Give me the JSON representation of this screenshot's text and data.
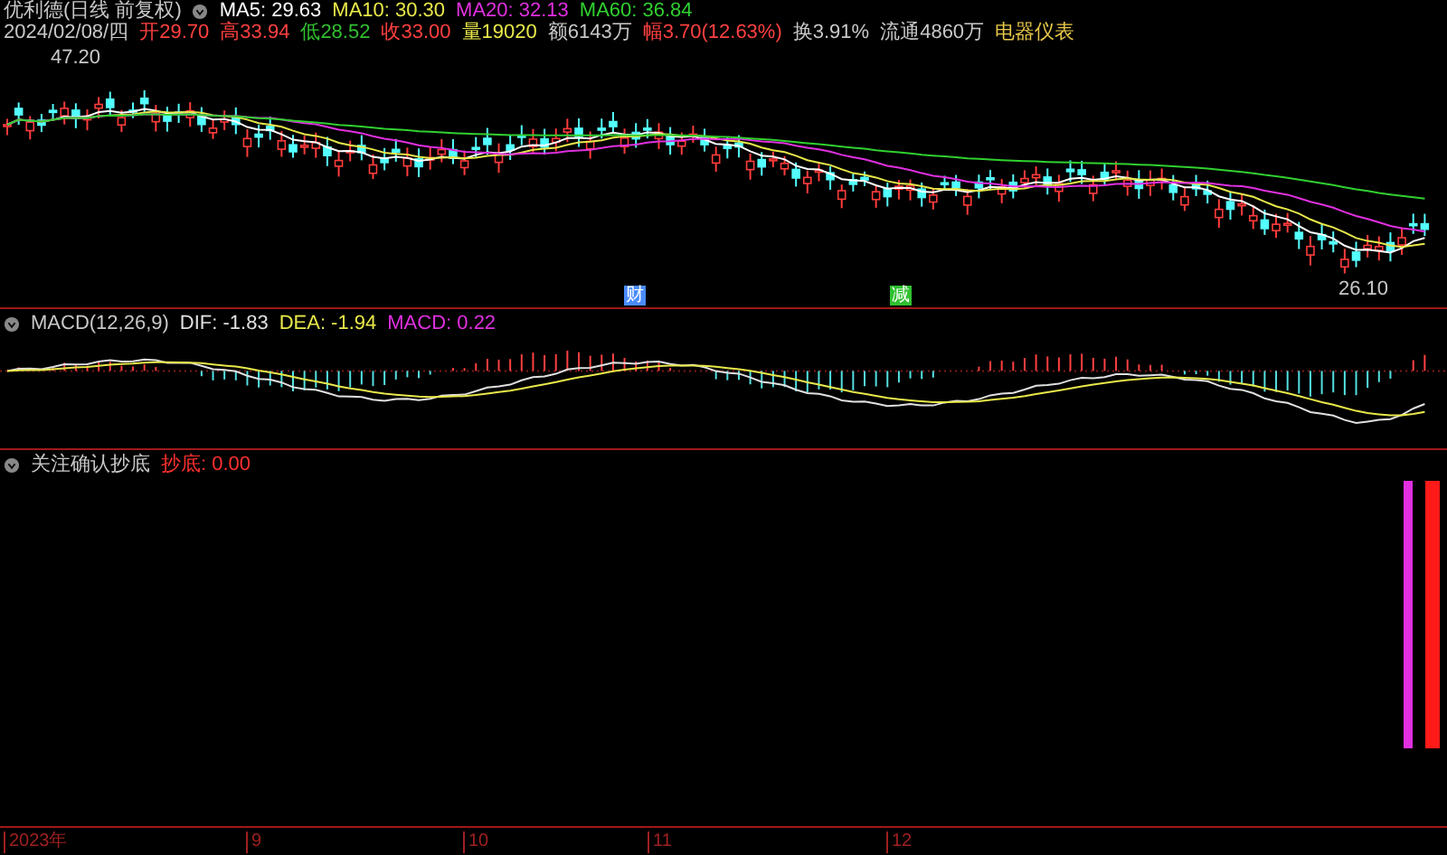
{
  "title": {
    "name": "优利德(日线 前复权)",
    "ma": [
      {
        "label": "MA5: 29.63",
        "color": "#ffffff"
      },
      {
        "label": "MA10: 30.30",
        "color": "#e8e84a"
      },
      {
        "label": "MA20: 32.13",
        "color": "#e030e0"
      },
      {
        "label": "MA60: 36.84",
        "color": "#30d030"
      }
    ]
  },
  "quote": [
    {
      "text": "2024/02/08/四",
      "color": "#c8c8c8"
    },
    {
      "text": "开29.70",
      "color": "#ff4040"
    },
    {
      "text": "高33.94",
      "color": "#ff4040"
    },
    {
      "text": "低28.52",
      "color": "#30c030"
    },
    {
      "text": "收33.00",
      "color": "#ff4040"
    },
    {
      "text": "量19020",
      "color": "#e8e84a"
    },
    {
      "text": "额6143万",
      "color": "#c8c8c8"
    },
    {
      "text": "幅3.70(12.63%)",
      "color": "#ff4040"
    },
    {
      "text": "换3.91%",
      "color": "#c8c8c8"
    },
    {
      "text": "流通4860万",
      "color": "#c8c8c8"
    },
    {
      "text": "电器仪表",
      "color": "#e8c84a"
    }
  ],
  "price_panel": {
    "high_label": "47.20",
    "low_label": "26.10",
    "events": [
      {
        "text": "财",
        "color": "#4a8cff"
      },
      {
        "text": "减",
        "color": "#30c030"
      }
    ]
  },
  "macd": {
    "name": "MACD(12,26,9)",
    "values": [
      {
        "text": "DIF: -1.83",
        "color": "#e0e0e0"
      },
      {
        "text": "DEA: -1.94",
        "color": "#e8e84a"
      },
      {
        "text": "MACD: 0.22",
        "color": "#e030e0"
      }
    ]
  },
  "indicator": {
    "name": "关注确认抄底",
    "values": [
      {
        "text": "抄底: 0.00",
        "color": "#ff3030"
      }
    ]
  },
  "axis": [
    "2023年",
    "9",
    "10",
    "11",
    "12"
  ]
}
